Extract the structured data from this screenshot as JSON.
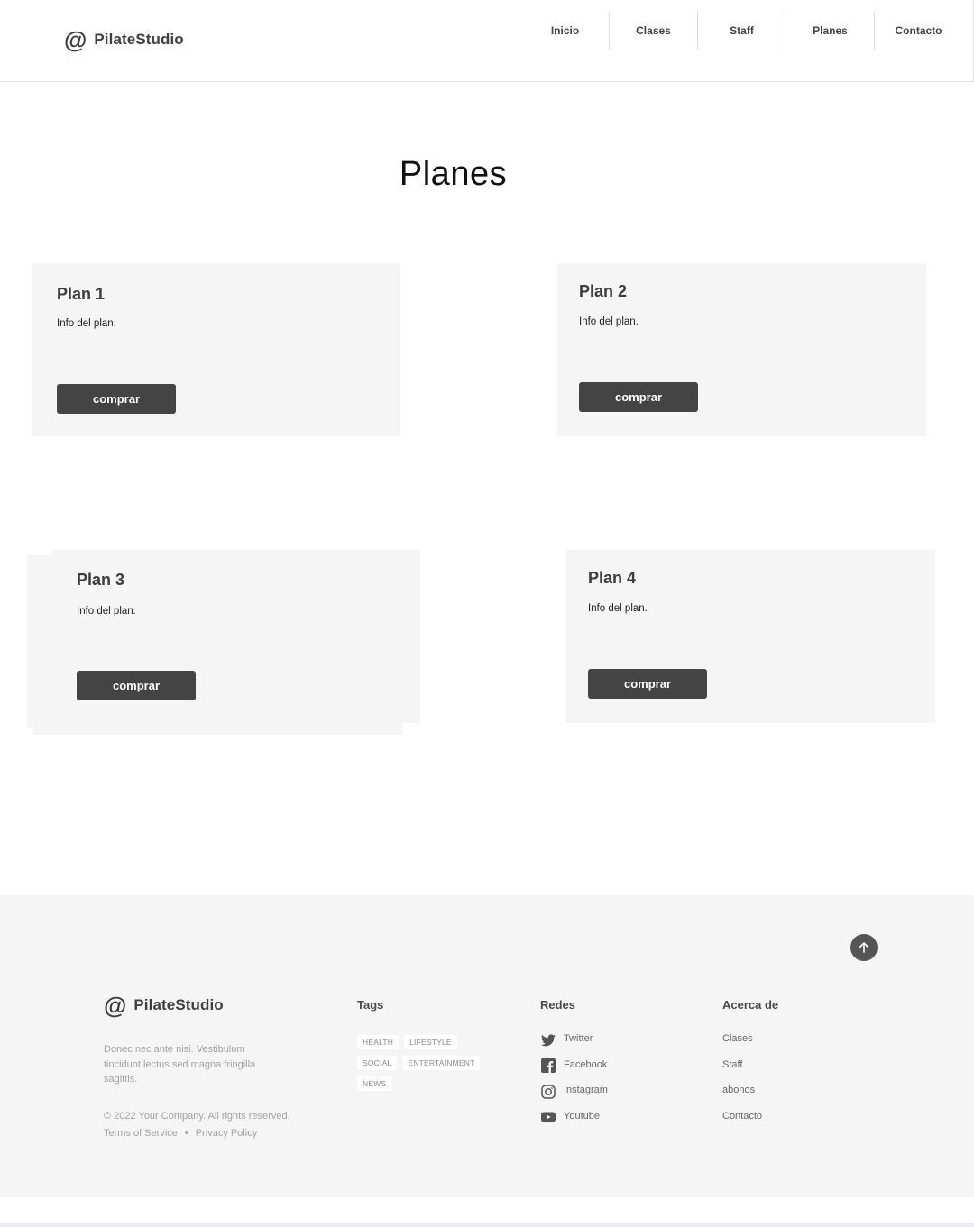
{
  "brand": {
    "name": "PilateStudio"
  },
  "nav": {
    "items": [
      "Inicio",
      "Clases",
      "Staff",
      "Planes",
      "Contacto"
    ]
  },
  "page": {
    "title": "Planes"
  },
  "plans": [
    {
      "title": "Plan 1",
      "info": "Info del plan.",
      "button": "comprar"
    },
    {
      "title": "Plan 2",
      "info": "Info del plan.",
      "button": "comprar"
    },
    {
      "title": "Plan 3",
      "info": "Info del plan.",
      "button": "comprar"
    },
    {
      "title": "Plan 4",
      "info": "Info del plan.",
      "button": "comprar"
    }
  ],
  "footer": {
    "brand": "PilateStudio",
    "description": "Donec nec ante nisi. Vestibulum tincidunt lectus sed magna fringilla sagittis.",
    "copyright": "© 2022 Your Company.  All rights reserved.",
    "terms": "Terms of Service",
    "separator": "•",
    "privacy": "Privacy Policy",
    "tags_heading": "Tags",
    "tags": [
      "HEALTH",
      "LIFESTYLE",
      "SOCIAL",
      "ENTERTAINMENT",
      "NEWS"
    ],
    "social_heading": "Redes",
    "social": [
      {
        "label": "Twitter",
        "icon": "twitter-icon"
      },
      {
        "label": "Facebook",
        "icon": "facebook-icon"
      },
      {
        "label": "Instagram",
        "icon": "instagram-icon"
      },
      {
        "label": "Youtube",
        "icon": "youtube-icon"
      }
    ],
    "about_heading": "Acerca de",
    "about": [
      "Clases",
      "Staff",
      "abonos",
      "Contacto"
    ]
  },
  "colors": {
    "button": "#444444",
    "card_bg": "#f5f5f5",
    "footer_bg": "#f5f5f5"
  }
}
